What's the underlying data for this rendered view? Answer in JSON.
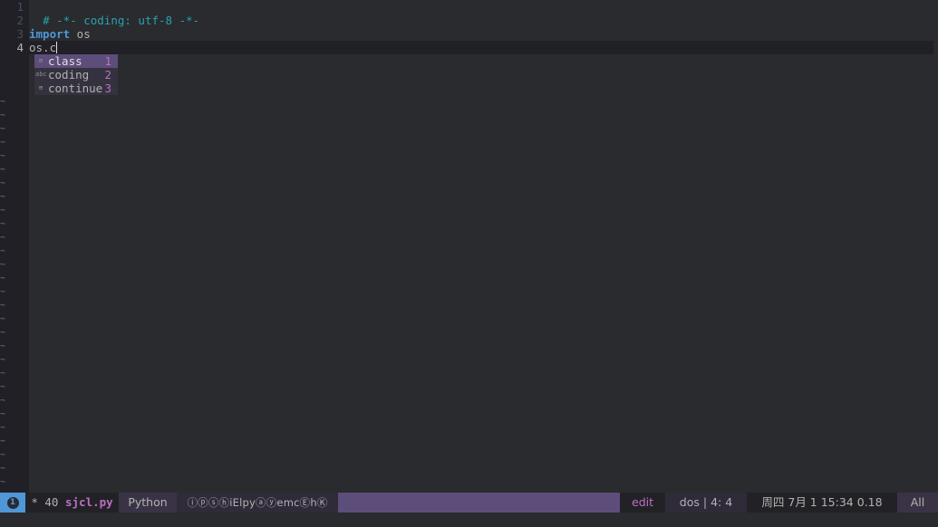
{
  "editor": {
    "line_numbers": [
      "1",
      "2",
      "3",
      "4"
    ],
    "line1_comment": "# -*- coding: utf-8 -*-",
    "line3_keyword": "import",
    "line3_rest": " os",
    "line4_text": "os.c",
    "tilde": "~"
  },
  "completion": {
    "items": [
      {
        "icon": "⊞",
        "label": "class",
        "number": "1"
      },
      {
        "icon": "abc",
        "label": "coding",
        "number": "2"
      },
      {
        "icon": "⊞",
        "label": "continue",
        "number": "3"
      }
    ]
  },
  "modeline": {
    "window_number": "1",
    "modified": "*",
    "size": "40",
    "filename": "sjcl.py",
    "major_mode": "Python",
    "minor_modes": "ⓘⓟⓢⓗiElpyⓐⓨemcⒺhⓀ",
    "state": "edit",
    "eol": "dos",
    "position": "4: 4",
    "datetime": "周四 7月  1 15:34",
    "load": "0.18",
    "scroll": "All"
  },
  "colors": {
    "background": "#292b2e",
    "comment": "#2aa1ae",
    "keyword": "#4f97d7",
    "modeline": "#5d4d7a",
    "accent": "#bc6ec5"
  }
}
